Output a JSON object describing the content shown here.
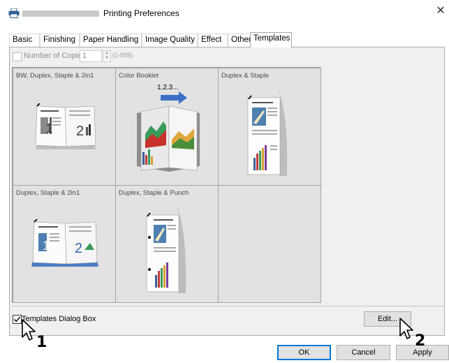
{
  "window": {
    "title": "Printing Preferences",
    "close_glyph": "✕"
  },
  "tabs": [
    {
      "label": "Basic"
    },
    {
      "label": "Finishing"
    },
    {
      "label": "Paper Handling"
    },
    {
      "label": "Image Quality"
    },
    {
      "label": "Effect"
    },
    {
      "label": "Others"
    },
    {
      "label": "Templates",
      "active": true
    }
  ],
  "copies": {
    "label": "Number of Copies:",
    "value": "1",
    "range": "(1-999)",
    "checked": false
  },
  "templates": [
    {
      "label": "BW, Duplex, Staple & 2in1",
      "thumb": "booklet-2in1-bw"
    },
    {
      "label": "Color Booklet",
      "thumb": "color-booklet"
    },
    {
      "label": "Duplex & Staple",
      "thumb": "duplex-staple"
    },
    {
      "label": "Duplex, Staple & 2in1",
      "thumb": "booklet-2in1-color"
    },
    {
      "label": "Duplex, Staple & Punch",
      "thumb": "duplex-punch"
    }
  ],
  "thumb_text": {
    "page1": "1",
    "page2": "2",
    "sequence": "1.2.3..."
  },
  "templates_dialog": {
    "label": "Templates Dialog Box",
    "checked": true
  },
  "buttons": {
    "edit": "Edit...",
    "ok": "OK",
    "cancel": "Cancel",
    "apply": "Apply"
  },
  "callouts": {
    "one": "1",
    "two": "2"
  },
  "colors": {
    "accent_blue": "#0078d7",
    "panel_bg": "#f0f0f0",
    "cell_bg": "#e2e2e2"
  }
}
